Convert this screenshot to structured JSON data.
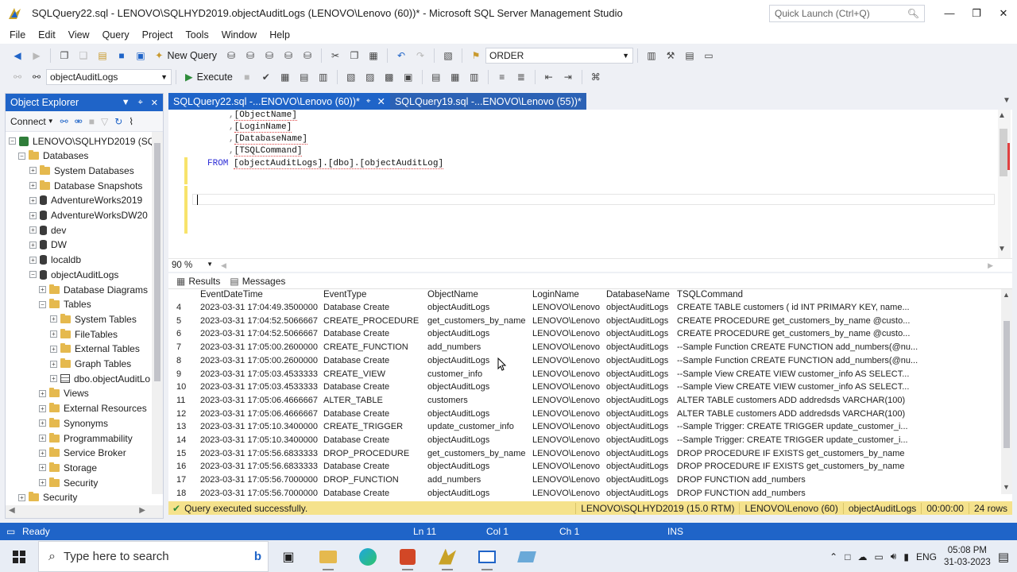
{
  "window": {
    "title": "SQLQuery22.sql - LENOVO\\SQLHYD2019.objectAuditLogs (LENOVO\\Lenovo (60))* - Microsoft SQL Server Management Studio",
    "quick_launch_placeholder": "Quick Launch (Ctrl+Q)"
  },
  "menu": [
    "File",
    "Edit",
    "View",
    "Query",
    "Project",
    "Tools",
    "Window",
    "Help"
  ],
  "toolbar": {
    "new_query_label": "New Query",
    "find_combo_value": "ORDER",
    "database_combo_value": "objectAuditLogs",
    "execute_label": "Execute"
  },
  "object_explorer": {
    "title": "Object Explorer",
    "connect_label": "Connect",
    "nodes": [
      {
        "label": "LENOVO\\SQLHYD2019 (SQL",
        "level": 0,
        "expander": "−",
        "icon": "server"
      },
      {
        "label": "Databases",
        "level": 1,
        "expander": "−",
        "icon": "folder"
      },
      {
        "label": "System Databases",
        "level": 2,
        "expander": "+",
        "icon": "folder"
      },
      {
        "label": "Database Snapshots",
        "level": 2,
        "expander": "+",
        "icon": "folder"
      },
      {
        "label": "AdventureWorks2019",
        "level": 2,
        "expander": "+",
        "icon": "db"
      },
      {
        "label": "AdventureWorksDW20",
        "level": 2,
        "expander": "+",
        "icon": "db"
      },
      {
        "label": "dev",
        "level": 2,
        "expander": "+",
        "icon": "db"
      },
      {
        "label": "DW",
        "level": 2,
        "expander": "+",
        "icon": "db"
      },
      {
        "label": "localdb",
        "level": 2,
        "expander": "+",
        "icon": "db"
      },
      {
        "label": "objectAuditLogs",
        "level": 2,
        "expander": "−",
        "icon": "db"
      },
      {
        "label": "Database Diagrams",
        "level": 3,
        "expander": "+",
        "icon": "folder"
      },
      {
        "label": "Tables",
        "level": 3,
        "expander": "−",
        "icon": "folder"
      },
      {
        "label": "System Tables",
        "level": 4,
        "expander": "+",
        "icon": "folder"
      },
      {
        "label": "FileTables",
        "level": 4,
        "expander": "+",
        "icon": "folder"
      },
      {
        "label": "External Tables",
        "level": 4,
        "expander": "+",
        "icon": "folder"
      },
      {
        "label": "Graph Tables",
        "level": 4,
        "expander": "+",
        "icon": "folder"
      },
      {
        "label": "dbo.objectAuditLo",
        "level": 4,
        "expander": "+",
        "icon": "table"
      },
      {
        "label": "Views",
        "level": 3,
        "expander": "+",
        "icon": "folder"
      },
      {
        "label": "External Resources",
        "level": 3,
        "expander": "+",
        "icon": "folder"
      },
      {
        "label": "Synonyms",
        "level": 3,
        "expander": "+",
        "icon": "folder"
      },
      {
        "label": "Programmability",
        "level": 3,
        "expander": "+",
        "icon": "folder"
      },
      {
        "label": "Service Broker",
        "level": 3,
        "expander": "+",
        "icon": "folder"
      },
      {
        "label": "Storage",
        "level": 3,
        "expander": "+",
        "icon": "folder"
      },
      {
        "label": "Security",
        "level": 3,
        "expander": "+",
        "icon": "folder"
      },
      {
        "label": "Security",
        "level": 1,
        "expander": "+",
        "icon": "folder"
      }
    ]
  },
  "doc_tabs": [
    {
      "label": "SQLQuery22.sql -...ENOVO\\Lenovo (60))*",
      "active": true
    },
    {
      "label": "SQLQuery19.sql -...ENOVO\\Lenovo (55))*",
      "active": false
    }
  ],
  "editor": {
    "lines": [
      {
        "prefix": ",",
        "text": "[ObjectName]"
      },
      {
        "prefix": ",",
        "text": "[LoginName]"
      },
      {
        "prefix": ",",
        "text": "[DatabaseName]"
      },
      {
        "prefix": ",",
        "text": "[TSQLCommand]"
      }
    ],
    "from_keyword": "FROM",
    "from_object": "[objectAuditLogs].[dbo].[objectAuditLog]",
    "zoom": "90 %"
  },
  "results": {
    "tabs": [
      "Results",
      "Messages"
    ],
    "columns": [
      "EventDateTime",
      "EventType",
      "ObjectName",
      "LoginName",
      "DatabaseName",
      "TSQLCommand"
    ],
    "rows": [
      [
        "4",
        "2023-03-31 17:04:49.3500000",
        "Database Create",
        "objectAuditLogs",
        "LENOVO\\Lenovo",
        "objectAuditLogs",
        "CREATE TABLE customers (   id INT PRIMARY KEY,   name..."
      ],
      [
        "5",
        "2023-03-31 17:04:52.5066667",
        "CREATE_PROCEDURE",
        "get_customers_by_name",
        "LENOVO\\Lenovo",
        "objectAuditLogs",
        "CREATE PROCEDURE get_customers_by_name  @custo..."
      ],
      [
        "6",
        "2023-03-31 17:04:52.5066667",
        "Database Create",
        "objectAuditLogs",
        "LENOVO\\Lenovo",
        "objectAuditLogs",
        "CREATE PROCEDURE get_customers_by_name  @custo..."
      ],
      [
        "7",
        "2023-03-31 17:05:00.2600000",
        "CREATE_FUNCTION",
        "add_numbers",
        "LENOVO\\Lenovo",
        "objectAuditLogs",
        "--Sample Function  CREATE FUNCTION add_numbers(@nu..."
      ],
      [
        "8",
        "2023-03-31 17:05:00.2600000",
        "Database Create",
        "objectAuditLogs",
        "LENOVO\\Lenovo",
        "objectAuditLogs",
        "--Sample Function  CREATE FUNCTION add_numbers(@nu..."
      ],
      [
        "9",
        "2023-03-31 17:05:03.4533333",
        "CREATE_VIEW",
        "customer_info",
        "LENOVO\\Lenovo",
        "objectAuditLogs",
        "  --Sample View  CREATE VIEW customer_info AS   SELECT..."
      ],
      [
        "10",
        "2023-03-31 17:05:03.4533333",
        "Database Create",
        "objectAuditLogs",
        "LENOVO\\Lenovo",
        "objectAuditLogs",
        "  --Sample View  CREATE VIEW customer_info AS   SELECT..."
      ],
      [
        "11",
        "2023-03-31 17:05:06.4666667",
        "ALTER_TABLE",
        "customers",
        "LENOVO\\Lenovo",
        "objectAuditLogs",
        "ALTER TABLE customers ADD addredsds VARCHAR(100)"
      ],
      [
        "12",
        "2023-03-31 17:05:06.4666667",
        "Database Create",
        "objectAuditLogs",
        "LENOVO\\Lenovo",
        "objectAuditLogs",
        "ALTER TABLE customers ADD addredsds VARCHAR(100)"
      ],
      [
        "13",
        "2023-03-31 17:05:10.3400000",
        "CREATE_TRIGGER",
        "update_customer_info",
        "LENOVO\\Lenovo",
        "objectAuditLogs",
        "  --Sample Trigger:   CREATE TRIGGER update_customer_i..."
      ],
      [
        "14",
        "2023-03-31 17:05:10.3400000",
        "Database Create",
        "objectAuditLogs",
        "LENOVO\\Lenovo",
        "objectAuditLogs",
        "  --Sample Trigger:   CREATE TRIGGER update_customer_i..."
      ],
      [
        "15",
        "2023-03-31 17:05:56.6833333",
        "DROP_PROCEDURE",
        "get_customers_by_name",
        "LENOVO\\Lenovo",
        "objectAuditLogs",
        "DROP PROCEDURE IF EXISTS get_customers_by_name"
      ],
      [
        "16",
        "2023-03-31 17:05:56.6833333",
        "Database Create",
        "objectAuditLogs",
        "LENOVO\\Lenovo",
        "objectAuditLogs",
        "DROP PROCEDURE IF EXISTS get_customers_by_name"
      ],
      [
        "17",
        "2023-03-31 17:05:56.7000000",
        "DROP_FUNCTION",
        "add_numbers",
        "LENOVO\\Lenovo",
        "objectAuditLogs",
        "DROP FUNCTION add_numbers"
      ],
      [
        "18",
        "2023-03-31 17:05:56.7000000",
        "Database Create",
        "objectAuditLogs",
        "LENOVO\\Lenovo",
        "objectAuditLogs",
        "DROP FUNCTION add_numbers"
      ]
    ]
  },
  "query_status": {
    "message": "Query executed successfully.",
    "server": "LENOVO\\SQLHYD2019 (15.0 RTM)",
    "user": "LENOVO\\Lenovo (60)",
    "database": "objectAuditLogs",
    "elapsed": "00:00:00",
    "rows": "24 rows"
  },
  "statusbar": {
    "state": "Ready",
    "line": "Ln 11",
    "col": "Col 1",
    "ch": "Ch 1",
    "mode": "INS"
  },
  "taskbar": {
    "search_placeholder": "Type here to search",
    "language": "ENG",
    "time": "05:08 PM",
    "date": "31-03-2023"
  },
  "colors": {
    "accent": "#1f64c8",
    "status_yellow": "#f5e28c"
  }
}
